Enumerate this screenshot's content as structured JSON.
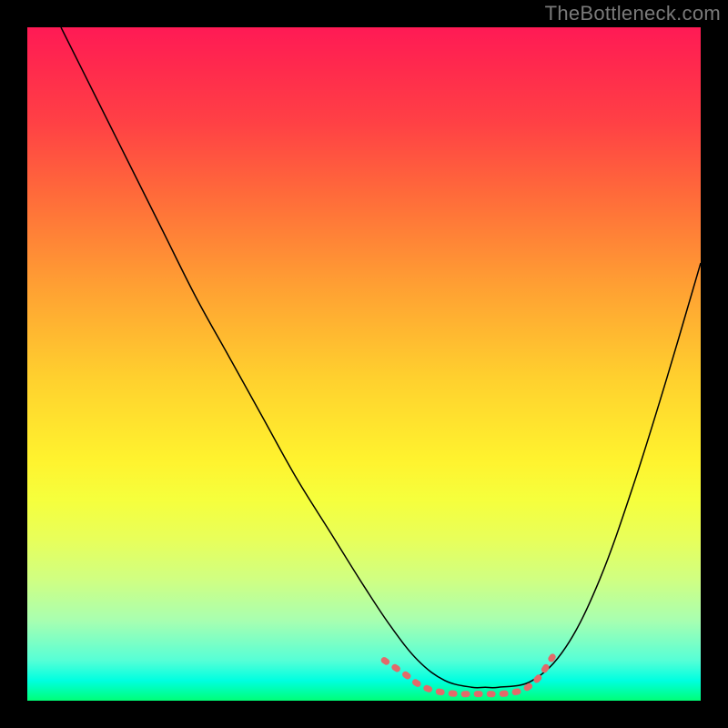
{
  "watermark": "TheBottleneck.com",
  "chart_data": {
    "type": "line",
    "title": "",
    "xlabel": "",
    "ylabel": "",
    "xlim": [
      0,
      100
    ],
    "ylim": [
      0,
      100
    ],
    "grid": false,
    "series": [
      {
        "name": "black-curve",
        "color": "#000000",
        "width": 1.5,
        "x": [
          5,
          10,
          15,
          20,
          25,
          30,
          35,
          40,
          45,
          50,
          54,
          58,
          62,
          66,
          68,
          70,
          75,
          80,
          85,
          90,
          95,
          100
        ],
        "values": [
          100,
          90,
          80,
          70,
          60,
          51,
          42,
          33,
          25,
          17,
          11,
          6,
          3,
          2,
          2,
          2,
          3,
          8,
          18,
          32,
          48,
          65
        ]
      },
      {
        "name": "pink-bottom-segment",
        "color": "#e26a6a",
        "width": 7,
        "dash": true,
        "x": [
          53,
          56,
          58,
          60,
          62,
          64,
          66,
          68,
          70,
          72,
          74,
          76,
          78
        ],
        "values": [
          6,
          4,
          2.5,
          1.6,
          1.2,
          1.0,
          1.0,
          1.0,
          1.0,
          1.2,
          1.8,
          3.5,
          6.5
        ]
      }
    ],
    "gradient_colors": {
      "top": "#ff1a55",
      "mid": "#fff22e",
      "bottom": "#00ff77"
    }
  }
}
